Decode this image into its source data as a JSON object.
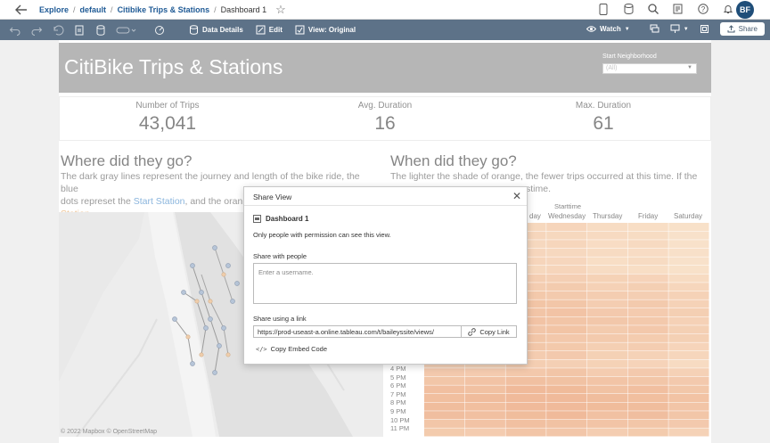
{
  "breadcrumbs": [
    {
      "label": "Explore"
    },
    {
      "label": "default"
    },
    {
      "label": "Citibike Trips & Stations"
    },
    {
      "label": "Dashboard 1"
    }
  ],
  "nav_icons": [
    "mobile-icon",
    "database-icon",
    "search-icon",
    "notes-icon",
    "help-icon",
    "bell-icon"
  ],
  "user": {
    "initials": "BF"
  },
  "toolbar": {
    "data_details": "Data Details",
    "edit": "Edit",
    "view": "View: Original",
    "watch": "Watch",
    "share": "Share"
  },
  "dashboard": {
    "title": "CitiBike Trips & Stations",
    "filter": {
      "label": "Start Neighborhood",
      "value": "(All)"
    },
    "kpis": [
      {
        "label": "Number of Trips",
        "value": "43,041"
      },
      {
        "label": "Avg. Duration",
        "value": "16"
      },
      {
        "label": "Max. Duration",
        "value": "61"
      }
    ],
    "left_panel": {
      "title": "Where did they go?",
      "text_a": "The dark gray lines represent the journey and length of the bike ride, the blue",
      "text_b": "dots represet the",
      "text_blue": "Start Station",
      "text_c": ", and the oran",
      "text_orange_tail": "Station",
      "text_d": "."
    },
    "map_credit": "© 2022 Mapbox  © OpenStreetMap",
    "right_panel": {
      "title": "When did they go?",
      "text_a": "The lighter the shade of orange, the fewer trips occurred at this time. If the",
      "text_b": "stime."
    },
    "heatmap": {
      "group_label": "Starttime",
      "days": [
        "Tuesday",
        "Wednesday",
        "Thursday",
        "Friday",
        "Saturday"
      ],
      "day_first_visible": "day",
      "hours": [
        "4 PM",
        "5 PM",
        "6 PM",
        "7 PM",
        "8 PM",
        "9 PM",
        "10 PM",
        "11 PM"
      ]
    }
  },
  "share_dialog": {
    "title": "Share View",
    "view_name": "Dashboard 1",
    "note": "Only people with permission can see this view.",
    "share_people_label": "Share with people",
    "username_placeholder": "Enter a username.",
    "share_link_label": "Share using a link",
    "link_url": "https://prod-useast-a.online.tableau.com/t/baileyssite/views/",
    "copy_link": "Copy Link",
    "copy_embed": "Copy Embed Code"
  },
  "colors": {
    "toolbar": "#5d7288",
    "title_band": "#8f8f8f",
    "link_blue": "#1f5a95",
    "heat_light": "#f6d5b2",
    "heat_dark": "#e8a77d"
  }
}
